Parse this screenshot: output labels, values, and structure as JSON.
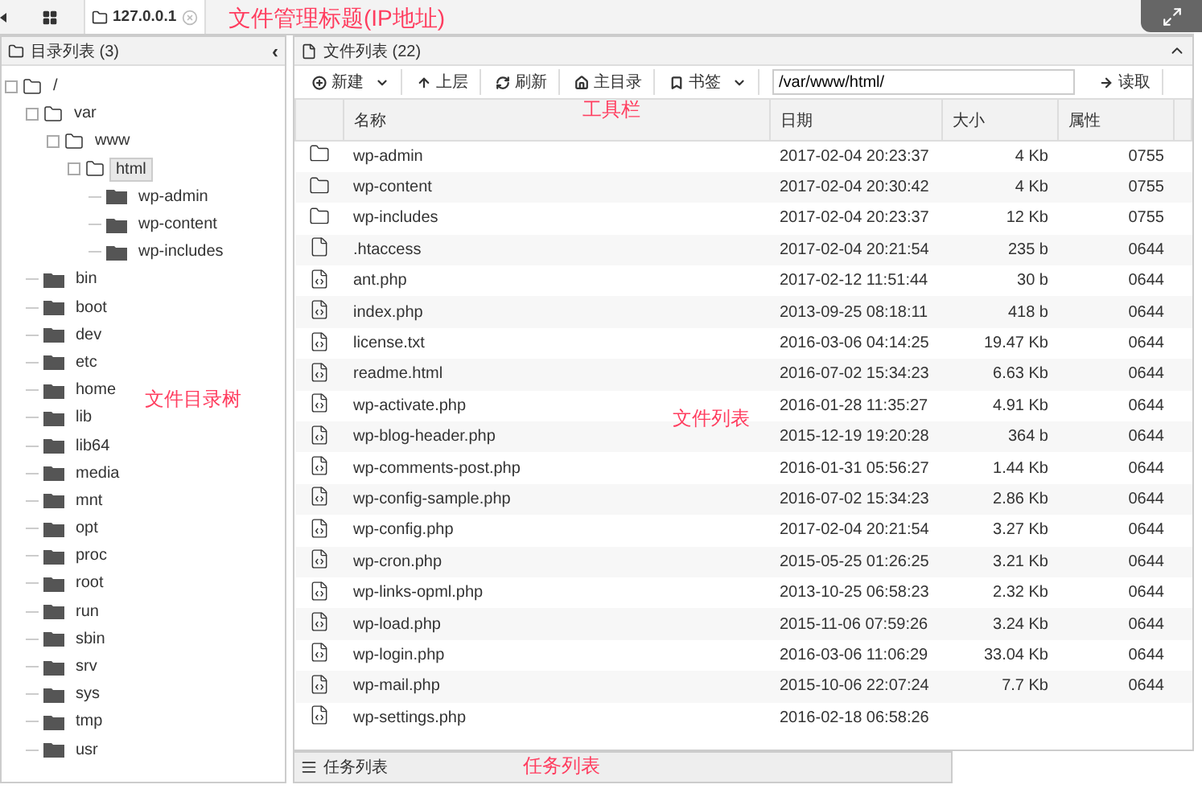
{
  "tabs": [
    {
      "kind": "grid",
      "selected": false
    },
    {
      "kind": "host",
      "label": "127.0.0.1",
      "selected": true
    }
  ],
  "tree_panel": {
    "title": "目录列表 (3)",
    "collapse": "‹"
  },
  "tree": [
    {
      "name": "/",
      "expanded": true,
      "selected": false,
      "children": [
        {
          "name": "var",
          "expanded": true,
          "selected": false,
          "children": [
            {
              "name": "www",
              "expanded": true,
              "selected": false,
              "children": [
                {
                  "name": "html",
                  "expanded": true,
                  "selected": true,
                  "children": [
                    {
                      "name": "wp-admin",
                      "expanded": false,
                      "selected": false
                    },
                    {
                      "name": "wp-content",
                      "expanded": false,
                      "selected": false
                    },
                    {
                      "name": "wp-includes",
                      "expanded": false,
                      "selected": false
                    }
                  ]
                }
              ]
            }
          ]
        },
        {
          "name": "bin",
          "expanded": false,
          "selected": false
        },
        {
          "name": "boot",
          "expanded": false,
          "selected": false
        },
        {
          "name": "dev",
          "expanded": false,
          "selected": false
        },
        {
          "name": "etc",
          "expanded": false,
          "selected": false
        },
        {
          "name": "home",
          "expanded": false,
          "selected": false
        },
        {
          "name": "lib",
          "expanded": false,
          "selected": false
        },
        {
          "name": "lib64",
          "expanded": false,
          "selected": false
        },
        {
          "name": "media",
          "expanded": false,
          "selected": false
        },
        {
          "name": "mnt",
          "expanded": false,
          "selected": false
        },
        {
          "name": "opt",
          "expanded": false,
          "selected": false
        },
        {
          "name": "proc",
          "expanded": false,
          "selected": false
        },
        {
          "name": "root",
          "expanded": false,
          "selected": false
        },
        {
          "name": "run",
          "expanded": false,
          "selected": false
        },
        {
          "name": "sbin",
          "expanded": false,
          "selected": false
        },
        {
          "name": "srv",
          "expanded": false,
          "selected": false
        },
        {
          "name": "sys",
          "expanded": false,
          "selected": false
        },
        {
          "name": "tmp",
          "expanded": false,
          "selected": false
        },
        {
          "name": "usr",
          "expanded": false,
          "selected": false
        }
      ]
    }
  ],
  "file_panel": {
    "title": "文件列表 (22)"
  },
  "toolbar": [
    {
      "kind": "new",
      "label": "新建",
      "dropdown": true
    },
    {
      "kind": "up",
      "label": "上层",
      "dropdown": false
    },
    {
      "kind": "refresh",
      "label": "刷新",
      "dropdown": false
    },
    {
      "kind": "home",
      "label": "主目录",
      "dropdown": false
    },
    {
      "kind": "bookmark",
      "label": "书签",
      "dropdown": true
    }
  ],
  "path": {
    "value": "/var/www/html/",
    "button": "读取"
  },
  "table": {
    "columns": [
      "名称",
      "日期",
      "大小",
      "属性"
    ],
    "rows": [
      {
        "kind": "folder",
        "name": "wp-admin",
        "date": "2017-02-04 20:23:37",
        "size": "4 Kb",
        "perm": "0755"
      },
      {
        "kind": "folder",
        "name": "wp-content",
        "date": "2017-02-04 20:30:42",
        "size": "4 Kb",
        "perm": "0755"
      },
      {
        "kind": "folder",
        "name": "wp-includes",
        "date": "2017-02-04 20:23:37",
        "size": "12 Kb",
        "perm": "0755"
      },
      {
        "kind": "file",
        "name": ".htaccess",
        "date": "2017-02-04 20:21:54",
        "size": "235 b",
        "perm": "0644"
      },
      {
        "kind": "code",
        "name": "ant.php",
        "date": "2017-02-12 11:51:44",
        "size": "30 b",
        "perm": "0644"
      },
      {
        "kind": "code",
        "name": "index.php",
        "date": "2013-09-25 08:18:11",
        "size": "418 b",
        "perm": "0644"
      },
      {
        "kind": "code",
        "name": "license.txt",
        "date": "2016-03-06 04:14:25",
        "size": "19.47 Kb",
        "perm": "0644"
      },
      {
        "kind": "code",
        "name": "readme.html",
        "date": "2016-07-02 15:34:23",
        "size": "6.63 Kb",
        "perm": "0644"
      },
      {
        "kind": "code",
        "name": "wp-activate.php",
        "date": "2016-01-28 11:35:27",
        "size": "4.91 Kb",
        "perm": "0644"
      },
      {
        "kind": "code",
        "name": "wp-blog-header.php",
        "date": "2015-12-19 19:20:28",
        "size": "364 b",
        "perm": "0644"
      },
      {
        "kind": "code",
        "name": "wp-comments-post.php",
        "date": "2016-01-31 05:56:27",
        "size": "1.44 Kb",
        "perm": "0644"
      },
      {
        "kind": "code",
        "name": "wp-config-sample.php",
        "date": "2016-07-02 15:34:23",
        "size": "2.86 Kb",
        "perm": "0644"
      },
      {
        "kind": "code",
        "name": "wp-config.php",
        "date": "2017-02-04 20:21:54",
        "size": "3.27 Kb",
        "perm": "0644"
      },
      {
        "kind": "code",
        "name": "wp-cron.php",
        "date": "2015-05-25 01:26:25",
        "size": "3.21 Kb",
        "perm": "0644"
      },
      {
        "kind": "code",
        "name": "wp-links-opml.php",
        "date": "2013-10-25 06:58:23",
        "size": "2.32 Kb",
        "perm": "0644"
      },
      {
        "kind": "code",
        "name": "wp-load.php",
        "date": "2015-11-06 07:59:26",
        "size": "3.24 Kb",
        "perm": "0644"
      },
      {
        "kind": "code",
        "name": "wp-login.php",
        "date": "2016-03-06 11:06:29",
        "size": "33.04 Kb",
        "perm": "0644"
      },
      {
        "kind": "code",
        "name": "wp-mail.php",
        "date": "2015-10-06 22:07:24",
        "size": "7.7 Kb",
        "perm": "0644"
      },
      {
        "kind": "code",
        "name": "wp-settings.php",
        "date": "2016-02-18 06:58:26"
      }
    ]
  },
  "task_bar": {
    "title": "任务列表"
  },
  "annotations": [
    {
      "kind": "title",
      "text": "文件管理标题(IP地址)"
    },
    {
      "kind": "toolbar",
      "text": "工具栏"
    },
    {
      "kind": "tree",
      "text": "文件目录树"
    },
    {
      "kind": "list",
      "text": "文件列表"
    },
    {
      "kind": "tasks",
      "text": "任务列表"
    }
  ]
}
